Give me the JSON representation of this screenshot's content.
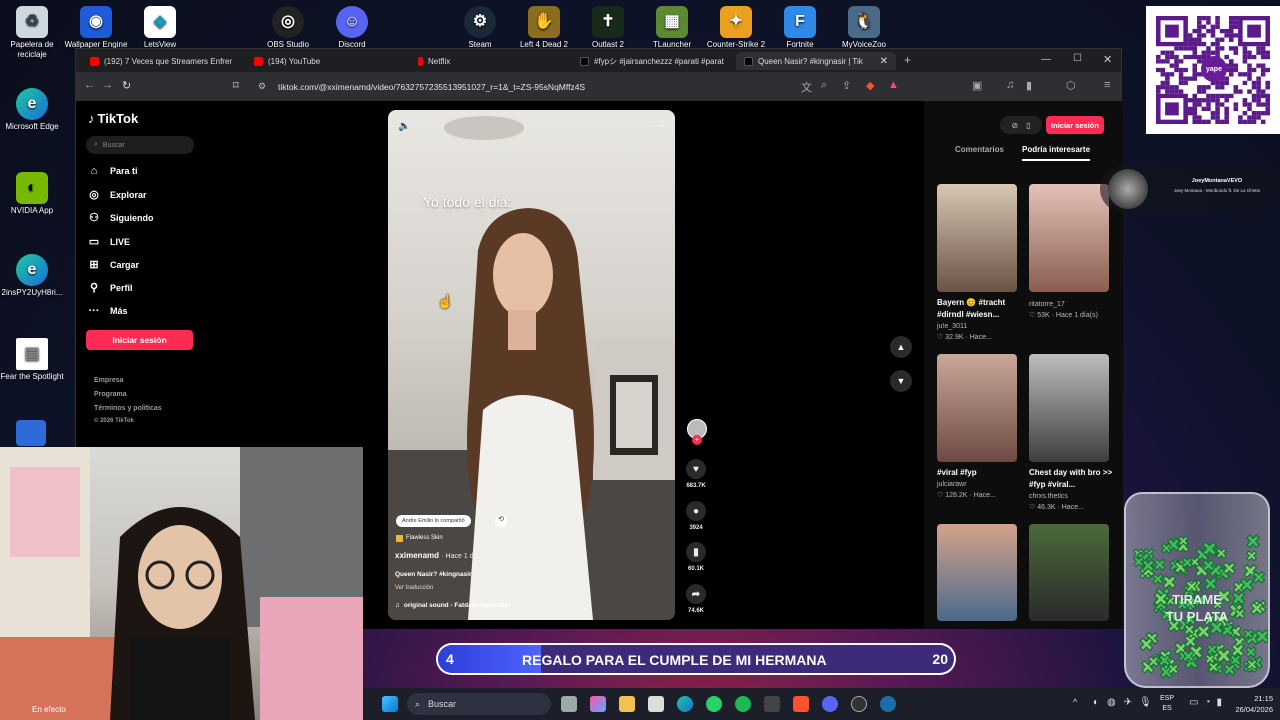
{
  "desktop": {
    "icons": [
      {
        "label": "Papelera de reciclaje"
      },
      {
        "label": "Wallpaper Engine"
      },
      {
        "label": "LetsView"
      },
      {
        "label": "OBS Studio"
      },
      {
        "label": "Discord"
      },
      {
        "label": "Steam"
      },
      {
        "label": "Left 4 Dead 2"
      },
      {
        "label": "Outlast 2"
      },
      {
        "label": "TLauncher"
      },
      {
        "label": "Counter-Strike 2"
      },
      {
        "label": "Fortnite"
      },
      {
        "label": "MyVoiceZoo"
      },
      {
        "label": "Microsoft Edge"
      },
      {
        "label": "NVIDIA App"
      },
      {
        "label": "2insPY2UyH8ri..."
      },
      {
        "label": "Fear the Spotlight"
      }
    ],
    "webcam_label": "En efecto"
  },
  "browser": {
    "tabs": [
      {
        "title": "(192) 7 Veces que Streamers Enfrenta"
      },
      {
        "title": "(194) YouTube"
      },
      {
        "title": "Netflix"
      },
      {
        "title": "#fypシ #jairsanchezzz #parati #parat"
      },
      {
        "title": "Queen Nasir? #kingnasir | Tik"
      }
    ],
    "url": "tiktok.com/@xximenamd/video/7632757235513951027_r=1&_t=ZS-95sNqMffz4S"
  },
  "tiktok": {
    "brand": "TikTok",
    "search_placeholder": "Buscar",
    "nav": [
      {
        "label": "Para ti",
        "icon": "home-icon"
      },
      {
        "label": "Explorar",
        "icon": "compass-icon"
      },
      {
        "label": "Siguiendo",
        "icon": "following-icon"
      },
      {
        "label": "LIVE",
        "icon": "live-icon"
      },
      {
        "label": "Cargar",
        "icon": "upload-icon"
      },
      {
        "label": "Perfil",
        "icon": "profile-icon"
      },
      {
        "label": "Más",
        "icon": "more-icon"
      }
    ],
    "login_label": "Iniciar sesión",
    "footer": [
      "Empresa",
      "Programa",
      "Términos y políticas",
      "© 2026 TikTok"
    ],
    "video": {
      "overlay_text": "Yo todo el dia:",
      "shared_by": "Andre Emilio lo compartió",
      "effect": "Flawless Skin",
      "author": "xximenamd",
      "time": "· Hace 1 día(s)",
      "caption": "Queen Nasir? #kingnasir",
      "translate": "Ver traducción",
      "sound": "original sound - Fatdancinglobster",
      "likes": "683.7K",
      "comments": "3924",
      "saves": "60.1K",
      "shares": "74.6K"
    },
    "right_tabs": [
      "Comentarios",
      "Podría interesarte"
    ],
    "recommended": [
      {
        "caption": "Bayern 😊 #tracht #dirndl #wiesn...",
        "user": "ju!e_3011",
        "meta": "32.9K · Hace...",
        "c1": "#d8c7b5",
        "c2": "#6b5345"
      },
      {
        "caption": "",
        "user": "ritatorre_17",
        "meta": "53K · Hace 1 día(s)",
        "c1": "#e4c2b8",
        "c2": "#8a5d50"
      },
      {
        "caption": "#viral #fyp",
        "user": "julciarawr",
        "meta": "128.2K · Hace...",
        "c1": "#c9a89a",
        "c2": "#6e4a42"
      },
      {
        "caption": "Chest day with bro >> #fyp #viral...",
        "user": "chrxs.thetics",
        "meta": "46.3K · Hace...",
        "c1": "#bdbdbd",
        "c2": "#3e3e3e"
      },
      {
        "caption": "",
        "user": "",
        "meta": "",
        "c1": "#d6a28a",
        "c2": "#4a6a8a"
      },
      {
        "caption": "",
        "user": "",
        "meta": "",
        "c1": "#4b6a3b",
        "c2": "#2a2a2a"
      }
    ],
    "popup": {
      "name": "JoeyMontanaVEVO",
      "song": "Joey Montana - Moribundo ft. De La Ghetto"
    }
  },
  "overlay": {
    "goal_current": "4",
    "goal_text": "REGALO PARA EL CUMPLE DE MI HERMANA",
    "goal_target": "20",
    "jar_text_1": "TIRAME",
    "jar_text_2": "TU PLATA",
    "qr_brand": "yape"
  },
  "taskbar": {
    "search": "Buscar",
    "lang1": "ESP",
    "lang2": "ES",
    "time": "21:15",
    "date": "26/04/2026"
  }
}
